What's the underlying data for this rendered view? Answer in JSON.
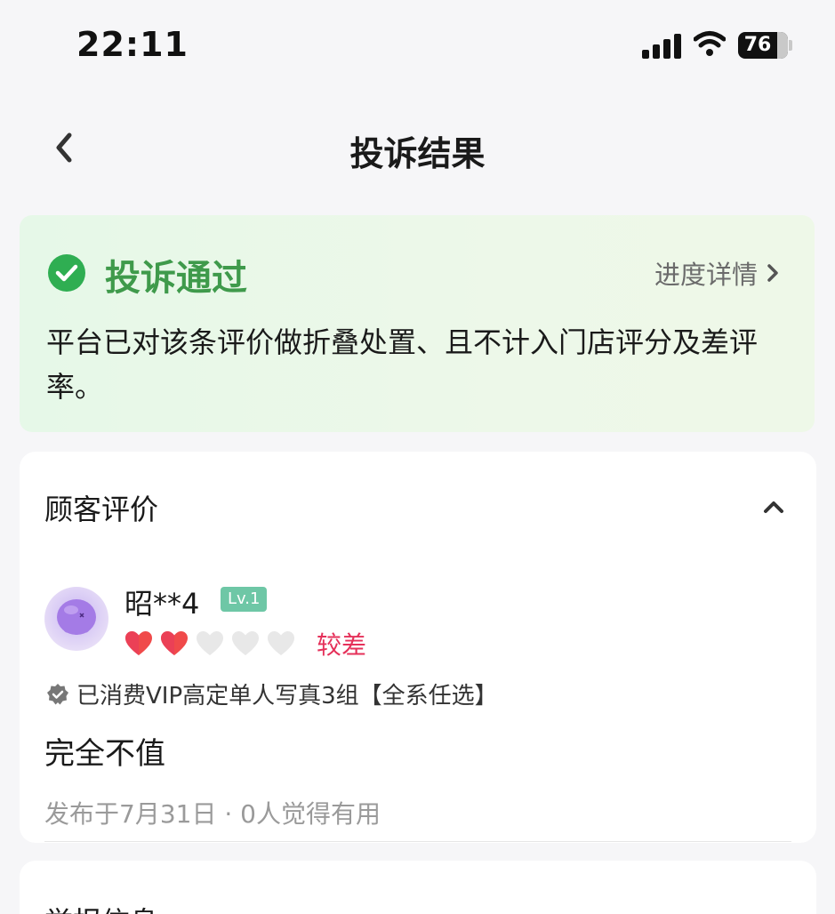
{
  "status_bar": {
    "time": "22:11",
    "battery": "76"
  },
  "header": {
    "title": "投诉结果",
    "back_icon": "chevron-left-icon"
  },
  "result": {
    "status": "投诉通过",
    "status_color": "#3f9a4b",
    "progress_link": "进度详情",
    "description": "平台已对该条评价做折叠处置、且不计入门店评分及差评率。"
  },
  "review_section": {
    "title": "顾客评价",
    "user": {
      "name": "昭**4",
      "level": "Lv.1"
    },
    "rating": {
      "filled": 2,
      "total": 5,
      "label": "较差",
      "color": "#e5315a"
    },
    "purchase": "已消费VIP高定单人写真3组【全系任选】",
    "text": "完全不值",
    "meta": "发布于7月31日 · 0人觉得有用"
  },
  "next_section": {
    "title": "举报信息"
  }
}
